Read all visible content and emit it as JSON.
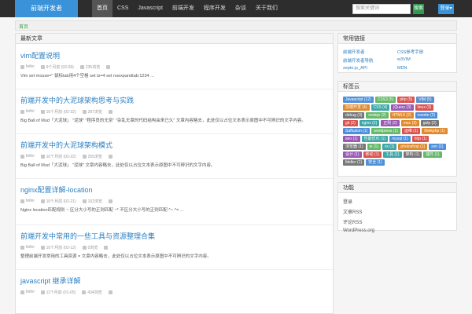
{
  "header": {
    "logo": "前端开发者",
    "nav": [
      {
        "label": "首页",
        "active": true
      },
      {
        "label": "CSS"
      },
      {
        "label": "Javascript"
      },
      {
        "label": "前端开发"
      },
      {
        "label": "程序开发"
      },
      {
        "label": "杂谈"
      },
      {
        "label": "关于我们"
      }
    ],
    "search": {
      "placeholder": "搜索关键词"
    },
    "search_btn": "搜索",
    "user_btn": "登录▾"
  },
  "breadcrumb": "首页",
  "main": {
    "title": "最新文章",
    "posts": [
      {
        "title": "vim配置说明",
        "author": "feifei",
        "date": "9个月前 (03-09)",
        "views": "235浏览",
        "excerpt": "Vim set mouse=\"  鼠标tab用4个空格 set ts=4 set noexpandtab:1234 ..."
      },
      {
        "title": "前端开发中的大泥球架构思考与实践",
        "author": "feifei",
        "date": "10个月前 (02-22)",
        "views": "287浏览",
        "excerpt": "Big Ball of Mud「大泥球」 \"泥球\" \"程序员的无奈\" \"杂乱无章的代码结构由来已久\" 文章内容略去，此处仅以占位文本表示原图中不可辨识的文字内容。"
      },
      {
        "title": "前端开发中的大泥球架构模式",
        "author": "feifei",
        "date": "10个月前 (02-22)",
        "views": "255浏览",
        "excerpt": "Big Ball of Mud「大泥球」 \"泥球\" 文章内容略去，此处仅以占位文本表示原图中不可辨识的文字内容。"
      },
      {
        "title": "nginx配置详解-location",
        "author": "feifei",
        "date": "10个月前 (02-21)",
        "views": "102浏览",
        "excerpt": "Nginx location匹配规则 ~      区分大小写的正则匹配 ~*    不区分大小写的正则匹配 ^~     ^= ..."
      },
      {
        "title": "前端开发中常用的一些工具与资源整理合集",
        "author": "feifei",
        "date": "10个月前 (02-12)",
        "views": "0浏览",
        "excerpt": "整理前端开发常用的工具资源 = 文章内容略去，此处仅以占位文本表示原图中不可辨识的文字内容。"
      },
      {
        "title": "javascript 继承详解",
        "author": "feifei",
        "date": "11个月前 (01-05)",
        "views": "434浏览",
        "excerpt": ""
      }
    ]
  },
  "sidebar": {
    "links_title": "常用链接",
    "links": [
      "前端开发者",
      "CSS参考手册",
      "前端开发者导航",
      "w3VIM",
      "zepto.js_API",
      "MDN"
    ],
    "tags_title": "标签云",
    "tags": [
      {
        "label": "Javascript (12)",
        "color": "#4e8fd9"
      },
      {
        "label": "CSS3 (5)",
        "color": "#66b86a"
      },
      {
        "label": "php (5)",
        "color": "#d9534f"
      },
      {
        "label": "VIM (5)",
        "color": "#5a8fd0"
      },
      {
        "label": "前端开发 (4)",
        "color": "#e08a2e"
      },
      {
        "label": "CSS (4)",
        "color": "#3ea7a7"
      },
      {
        "label": "jQuery (3)",
        "color": "#9b59b6"
      },
      {
        "label": "linux (3)",
        "color": "#d9534f"
      },
      {
        "label": "debug (3)",
        "color": "#777"
      },
      {
        "label": "nodejs (2)",
        "color": "#66b86a"
      },
      {
        "label": "HTML5 (2)",
        "color": "#e08a2e"
      },
      {
        "label": "rewrite (2)",
        "color": "#4e8fd9"
      },
      {
        "label": "git (2)",
        "color": "#d9534f"
      },
      {
        "label": "nginx (2)",
        "color": "#3ea7a7"
      },
      {
        "label": "正则 (2)",
        "color": "#9b59b6"
      },
      {
        "label": "mac (2)",
        "color": "#e08a2e"
      },
      {
        "label": "gulp (2)",
        "color": "#777"
      },
      {
        "label": "Suffusion (1)",
        "color": "#4e8fd9"
      },
      {
        "label": "wordpress (1)",
        "color": "#66b86a"
      },
      {
        "label": "运维 (1)",
        "color": "#d9534f"
      },
      {
        "label": "thinkphp (1)",
        "color": "#e08a2e"
      },
      {
        "label": "seo (1)",
        "color": "#9b59b6"
      },
      {
        "label": "性能优化 (1)",
        "color": "#3ea7a7"
      },
      {
        "label": "mysql (1)",
        "color": "#4e8fd9"
      },
      {
        "label": "http (1)",
        "color": "#d9534f"
      },
      {
        "label": "浏览器 (1)",
        "color": "#777"
      },
      {
        "label": "ie (1)",
        "color": "#66b86a"
      },
      {
        "label": "vs (1)",
        "color": "#3ea7a7"
      },
      {
        "label": "photoshop (1)",
        "color": "#e08a2e"
      },
      {
        "label": "svn (1)",
        "color": "#4e8fd9"
      },
      {
        "label": "设计 (1)",
        "color": "#9b59b6"
      },
      {
        "label": "移动 (1)",
        "color": "#d9534f"
      },
      {
        "label": "工具 (1)",
        "color": "#3ea7a7"
      },
      {
        "label": "架构 (1)",
        "color": "#777"
      },
      {
        "label": "插件 (1)",
        "color": "#66b86a"
      },
      {
        "label": "fiddler (1)",
        "color": "#777"
      },
      {
        "label": "安全 (1)",
        "color": "#4e8fd9"
      }
    ],
    "meta_title": "功能",
    "meta": [
      "登录",
      "文章RSS",
      "评论RSS",
      "WordPress.org"
    ]
  }
}
